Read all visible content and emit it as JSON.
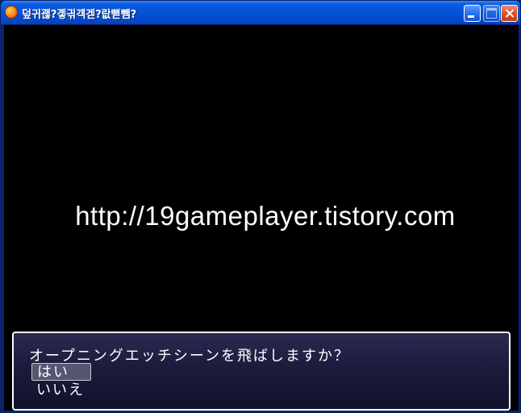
{
  "window": {
    "title": "덮귀괞?곟긖걕겓?랎뼏뺌?"
  },
  "game": {
    "watermark": "http://19gameplayer.tistory.com",
    "dialog": {
      "prompt": "オープニングエッチシーンを飛ばしますか？",
      "choices": [
        "はい",
        "いいえ"
      ],
      "selected_choice": "はい"
    }
  }
}
